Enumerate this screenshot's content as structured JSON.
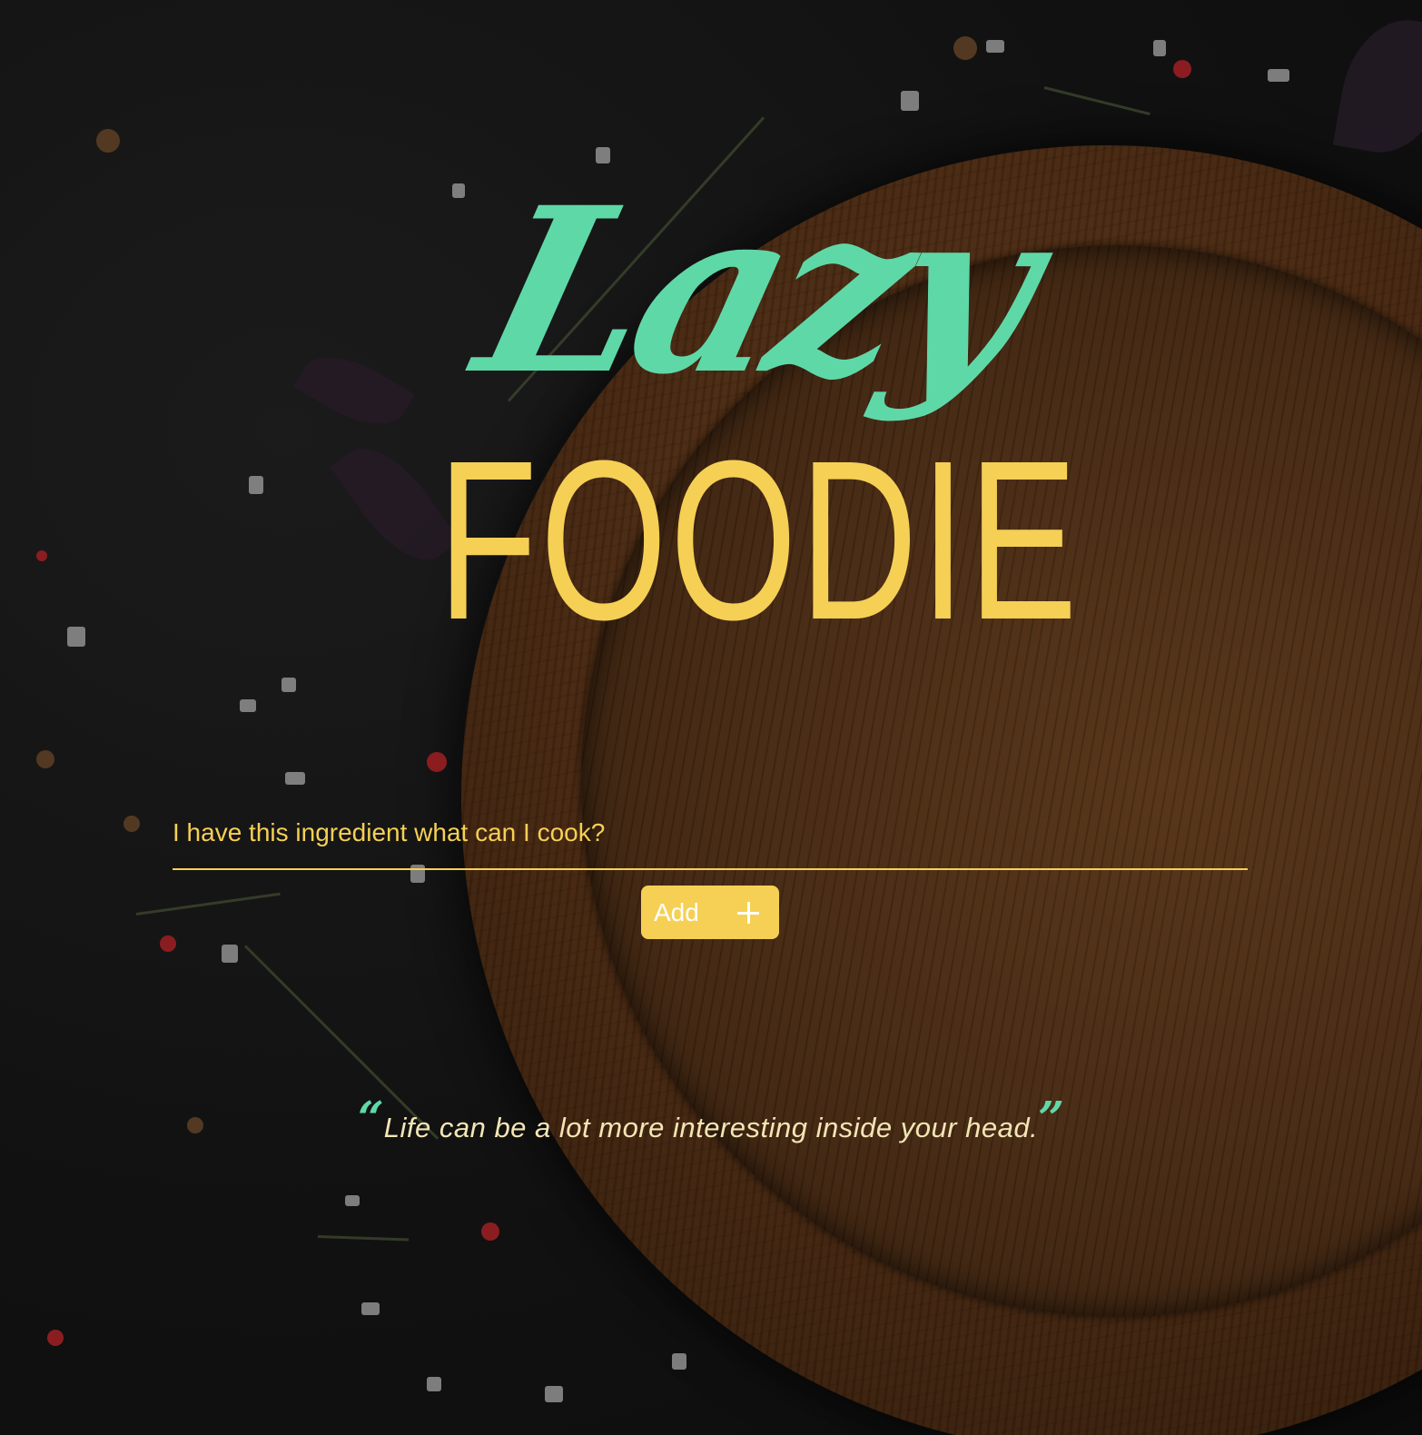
{
  "logo": {
    "word_top": "Lazy",
    "word_bottom": "FOODIE"
  },
  "search": {
    "placeholder": "I have this ingredient what can I cook?",
    "value": ""
  },
  "add_button": {
    "label": "Add",
    "icon": "plus-icon"
  },
  "quote": {
    "open_mark": "“",
    "text": "Life can be a lot more interesting inside your head.",
    "close_mark": "”"
  },
  "colors": {
    "accent_green": "#5fd8a8",
    "accent_yellow": "#f5d055",
    "background": "#161616"
  }
}
